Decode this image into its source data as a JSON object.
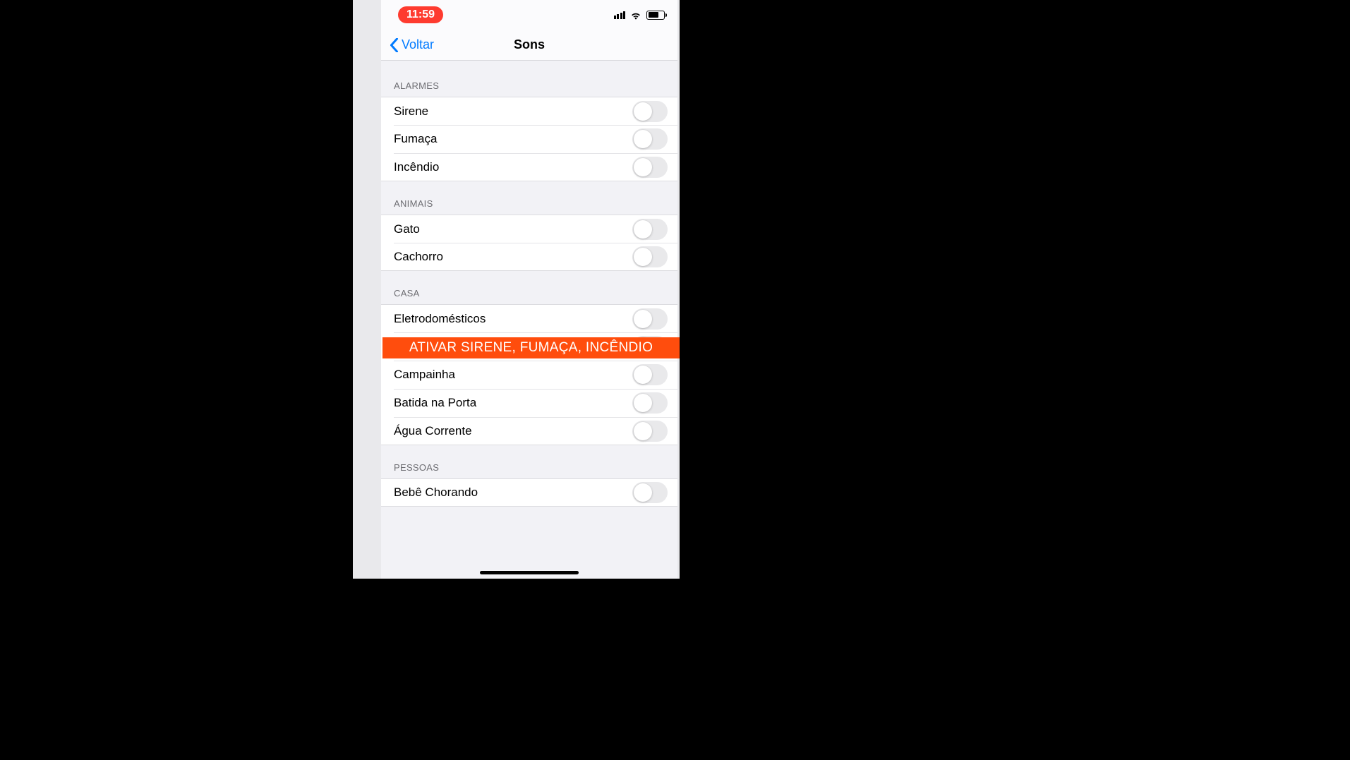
{
  "status": {
    "time": "11:59"
  },
  "nav": {
    "back_label": "Voltar",
    "title": "Sons"
  },
  "sections": [
    {
      "header": "ALARMES",
      "items": [
        {
          "label": "Sirene"
        },
        {
          "label": "Fumaça"
        },
        {
          "label": "Incêndio"
        }
      ]
    },
    {
      "header": "ANIMAIS",
      "items": [
        {
          "label": "Gato"
        },
        {
          "label": "Cachorro"
        }
      ]
    },
    {
      "header": "CASA",
      "items": [
        {
          "label": "Eletrodomésticos"
        },
        {
          "label": ""
        },
        {
          "label": "Campainha"
        },
        {
          "label": "Batida na Porta"
        },
        {
          "label": "Água Corrente"
        }
      ]
    },
    {
      "header": "PESSOAS",
      "items": [
        {
          "label": "Bebê Chorando"
        }
      ]
    }
  ],
  "banner_text": "ATIVAR SIRENE, FUMAÇA, INCÊNDIO"
}
